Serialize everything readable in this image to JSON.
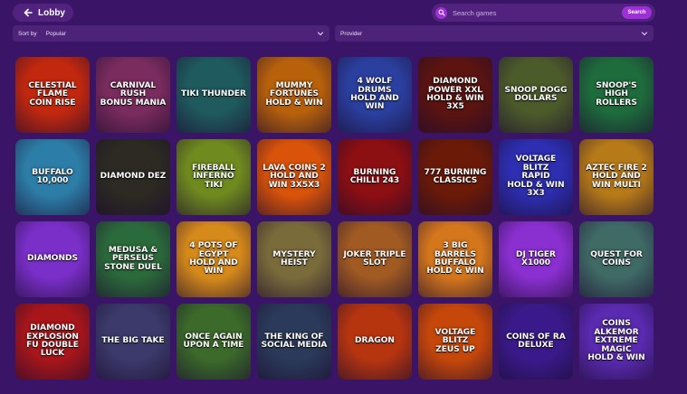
{
  "header": {
    "lobby_label": "Lobby",
    "search_placeholder": "Search games",
    "search_button": "Search"
  },
  "filters": {
    "sort_label": "Sort by",
    "sort_value": "Popular",
    "provider_label": "Provider"
  },
  "games": [
    {
      "title": "Celestial Flame\nCoin Rise",
      "bg": "#c2280e"
    },
    {
      "title": "Carnival Rush\nBonus Mania",
      "bg": "#7a2c5e"
    },
    {
      "title": "Tiki Thunder",
      "bg": "#1f5a5e"
    },
    {
      "title": "Mummy Fortunes\nHold & Win",
      "bg": "#b8610b"
    },
    {
      "title": "4 Wolf Drums\nHold and Win",
      "bg": "#2a3f9e"
    },
    {
      "title": "Diamond Power XXL\nHold & Win 3x5",
      "bg": "#5b1410"
    },
    {
      "title": "Snoop Dogg Dollars",
      "bg": "#4c5b2a"
    },
    {
      "title": "Snoop's High Rollers",
      "bg": "#1e6b3c"
    },
    {
      "title": "Buffalo 10,000",
      "bg": "#2c7ea8"
    },
    {
      "title": "Diamond Dez",
      "bg": "#2c2a22"
    },
    {
      "title": "Fireball Inferno\nTiki",
      "bg": "#6f8a1e"
    },
    {
      "title": "Lava Coins 2\nHold and Win 3x5x3",
      "bg": "#d9530a"
    },
    {
      "title": "Burning Chilli 243",
      "bg": "#8c0f12"
    },
    {
      "title": "777 Burning Classics",
      "bg": "#6b1a08"
    },
    {
      "title": "Voltage Blitz\nRapid\nHold & Win 3x3",
      "bg": "#2d2eb0"
    },
    {
      "title": "Aztec Fire 2\nHold and Win Multi",
      "bg": "#b67a18"
    },
    {
      "title": "Diamonds",
      "bg": "#7a2fc9"
    },
    {
      "title": "Medusa & Perseus\nStone Duel",
      "bg": "#2b6a3a"
    },
    {
      "title": "4 Pots of Egypt\nHold and Win",
      "bg": "#d68a1a"
    },
    {
      "title": "Mystery Heist",
      "bg": "#7a6b3a"
    },
    {
      "title": "Joker Triple Slot",
      "bg": "#a05a22"
    },
    {
      "title": "3 Big Barrels\nBuffalo\nHold & Win",
      "bg": "#d4761c"
    },
    {
      "title": "DJ Tiger\nx1000",
      "bg": "#8a2fd0"
    },
    {
      "title": "Quest for Coins",
      "bg": "#3f6a66"
    },
    {
      "title": "Diamond Explosion\nFu Double Luck",
      "bg": "#a8161a"
    },
    {
      "title": "The Big Take",
      "bg": "#3b3a6a"
    },
    {
      "title": "Once Again\nUpon a Time",
      "bg": "#3b6a2a"
    },
    {
      "title": "The King of\nSocial Media",
      "bg": "#2b3a5a"
    },
    {
      "title": "Dragon",
      "bg": "#b6350f"
    },
    {
      "title": "Voltage Blitz\nZeus Up",
      "bg": "#c6470a"
    },
    {
      "title": "Coins of Ra\nDeluxe",
      "bg": "#3a1a8a"
    },
    {
      "title": "Coins Alkemor\nExtreme Magic\nHold & Win",
      "bg": "#5a2ab0"
    }
  ]
}
